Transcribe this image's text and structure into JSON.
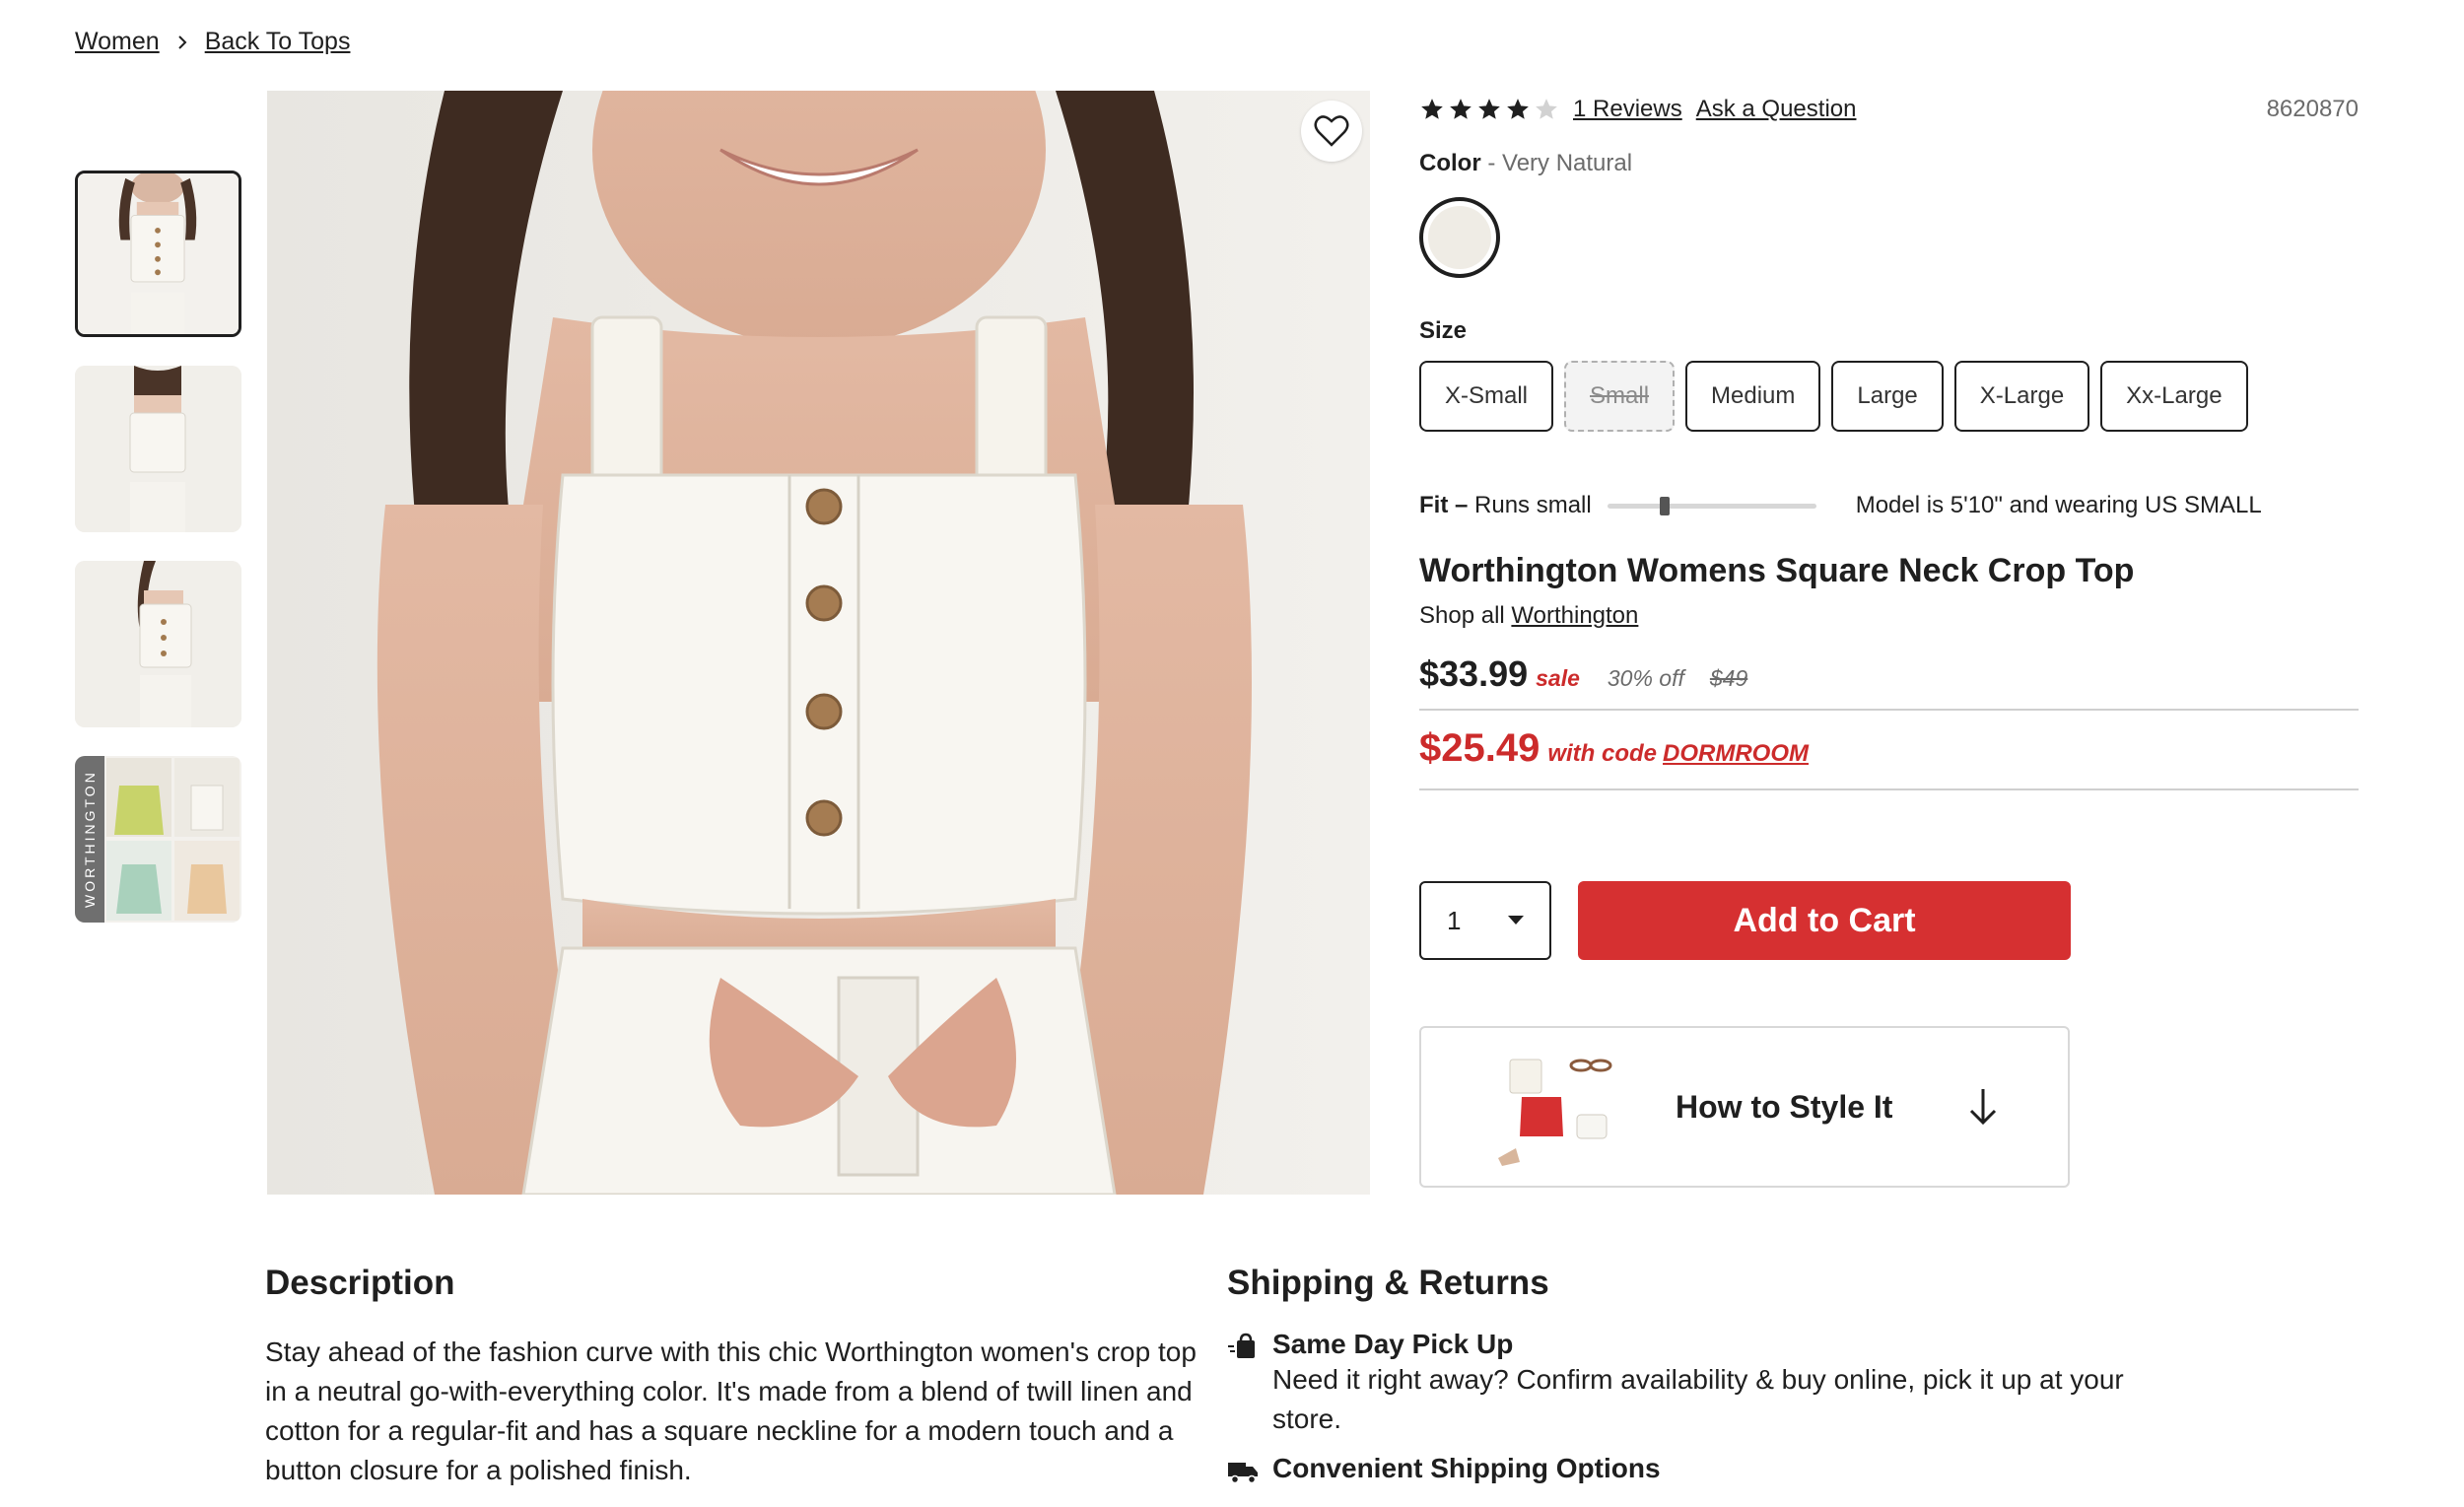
{
  "breadcrumb": {
    "item1": "Women",
    "item2": "Back To Tops"
  },
  "thumbnails": {
    "brand_strip": "WORTHINGTON"
  },
  "rating": {
    "stars": 4,
    "max": 5,
    "reviews_link": "1 Reviews",
    "question_link": "Ask a Question"
  },
  "sku": "8620870",
  "color": {
    "label": "Color",
    "value": "- Very Natural",
    "swatch_hex": "#efece5"
  },
  "size": {
    "label": "Size",
    "options": [
      "X-Small",
      "Small",
      "Medium",
      "Large",
      "X-Large",
      "Xx-Large"
    ],
    "unavailable": [
      "Small"
    ]
  },
  "fit": {
    "label": "Fit –",
    "value": "Runs small",
    "level": 0.25,
    "model_note": "Model is 5'10\" and wearing US SMALL"
  },
  "product": {
    "title": "Worthington Womens Square Neck Crop Top",
    "shop_all_prefix": "Shop all",
    "brand": "Worthington"
  },
  "pricing": {
    "price": "$33.99",
    "sale_tag": "sale",
    "discount": "30% off",
    "original": "$49",
    "promo_price": "$25.49",
    "promo_text": "with code",
    "promo_code": "DORMROOM"
  },
  "cart": {
    "quantity": "1",
    "add_label": "Add to Cart"
  },
  "style_it": {
    "label": "How to Style It"
  },
  "description": {
    "heading": "Description",
    "text": "Stay ahead of the fashion curve with this chic Worthington women's crop top in a neutral go-with-everything color. It's made from a blend of twill linen and cotton for a regular-fit and has a square neckline for a modern touch and a button closure for a polished finish."
  },
  "shipping": {
    "heading": "Shipping & Returns",
    "pickup_title": "Same Day Pick Up",
    "pickup_desc": "Need it right away? Confirm availability & buy online, pick it up at your store.",
    "options_title": "Convenient Shipping Options"
  },
  "colors": {
    "accent": "#d63031",
    "sale_red": "#cc2b2b",
    "text": "#1f1f1f",
    "muted": "#6b6b6b"
  }
}
